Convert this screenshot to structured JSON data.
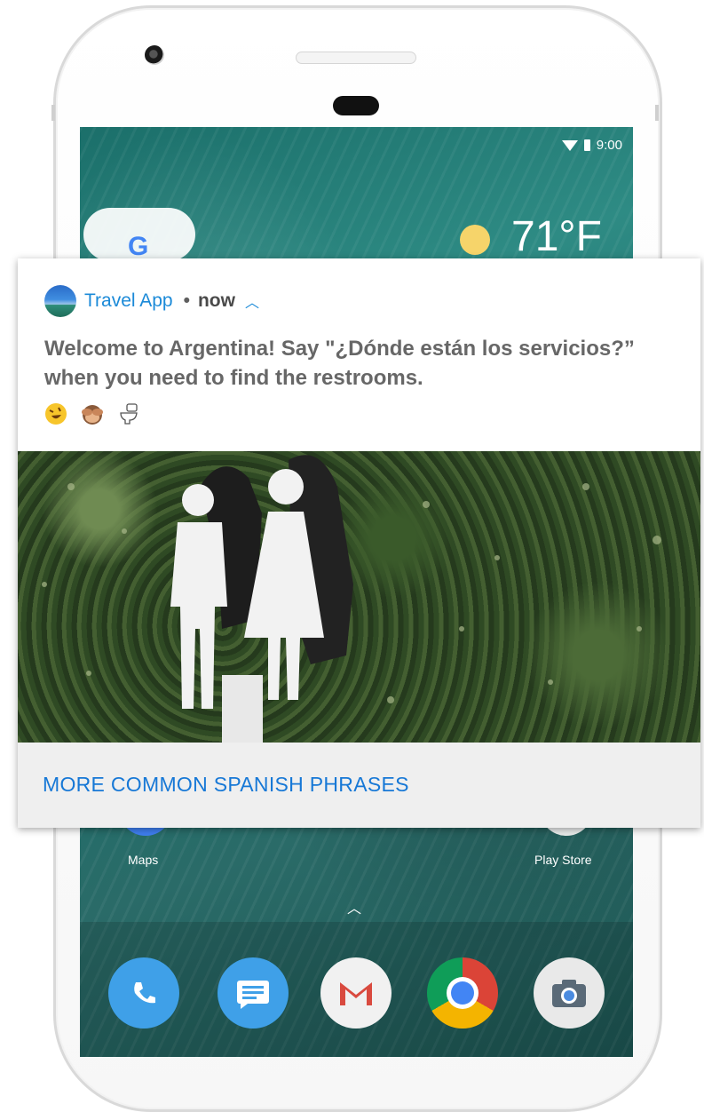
{
  "status_bar": {
    "time": "9:00"
  },
  "weather": {
    "temperature": "71°F"
  },
  "search_widget": {
    "letter": "G"
  },
  "notification": {
    "app_name": "Travel App",
    "separator": "•",
    "time": "now",
    "expand_icon": "chevron-up-icon",
    "message": "Welcome to Argentina! Say \"¿Dónde están los servicios?” when you need to find the restrooms.",
    "emojis": [
      "rolling-laughing-emoji",
      "see-no-evil-monkey-emoji",
      "toilet-emoji"
    ],
    "image_subject": "restroom-sign-photo",
    "action_label": "MORE COMMON SPANISH PHRASES"
  },
  "home_screen": {
    "apps": [
      {
        "label": "Maps",
        "icon": "maps-icon"
      },
      {
        "label": "Play Store",
        "icon": "play-store-icon"
      }
    ],
    "dock": [
      "phone-icon",
      "messages-icon",
      "gmail-icon",
      "chrome-icon",
      "camera-icon"
    ]
  },
  "colors": {
    "accent": "#1b8ad8",
    "action_text": "#1778d6",
    "message_text": "#676767",
    "action_bar_bg": "#efefef"
  }
}
